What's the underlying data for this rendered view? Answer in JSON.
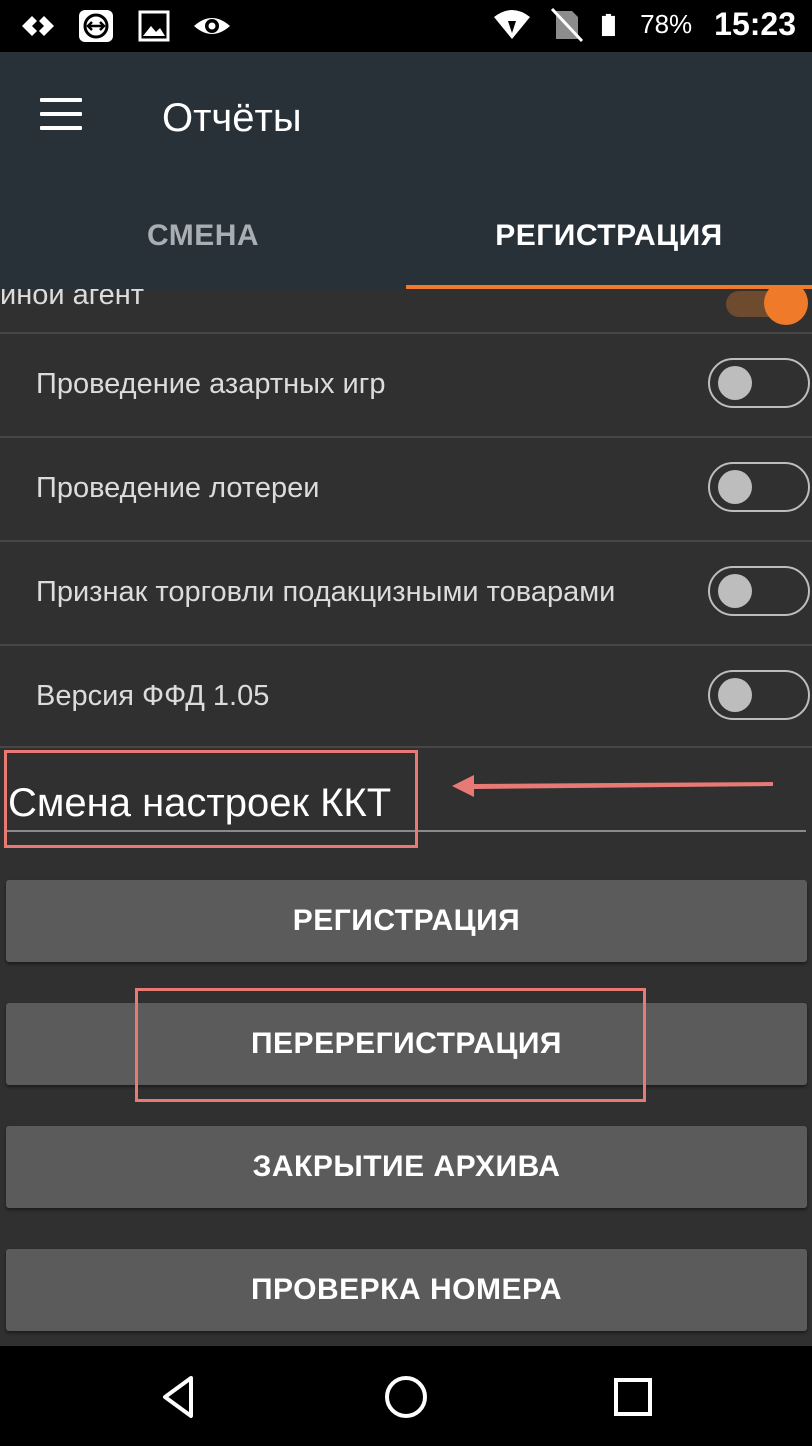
{
  "status_bar": {
    "icons": [
      "teamviewer-icon",
      "screen-share-icon",
      "image-icon",
      "eye-icon",
      "wifi-icon",
      "no-sim-icon",
      "battery-icon"
    ],
    "battery": "78%",
    "time": "15:23"
  },
  "app_bar": {
    "title": "Отчёты",
    "tabs": [
      {
        "label": "СМЕНА",
        "active": false
      },
      {
        "label": "РЕГИСТРАЦИЯ",
        "active": true
      }
    ]
  },
  "settings": {
    "partial_item": {
      "label": "иной агент",
      "enabled": true
    },
    "items": [
      {
        "label": "Проведение азартных игр",
        "enabled": false
      },
      {
        "label": "Проведение лотереи",
        "enabled": false
      },
      {
        "label": "Признак торговли подакцизными товарами",
        "enabled": false
      },
      {
        "label": "Версия ФФД 1.05",
        "enabled": false
      }
    ]
  },
  "section": {
    "title": "Смена настроек ККТ"
  },
  "actions": [
    {
      "label": "РЕГИСТРАЦИЯ"
    },
    {
      "label": "ПЕРЕРЕГИСТРАЦИЯ"
    },
    {
      "label": "ЗАКРЫТИЕ АРХИВА"
    },
    {
      "label": "ПРОВЕРКА НОМЕРА"
    }
  ],
  "colors": {
    "accent": "#ef7a2a",
    "app_bar": "#283038",
    "background": "#303030",
    "button": "#5b5b5c",
    "annotation": "#e87a76"
  }
}
